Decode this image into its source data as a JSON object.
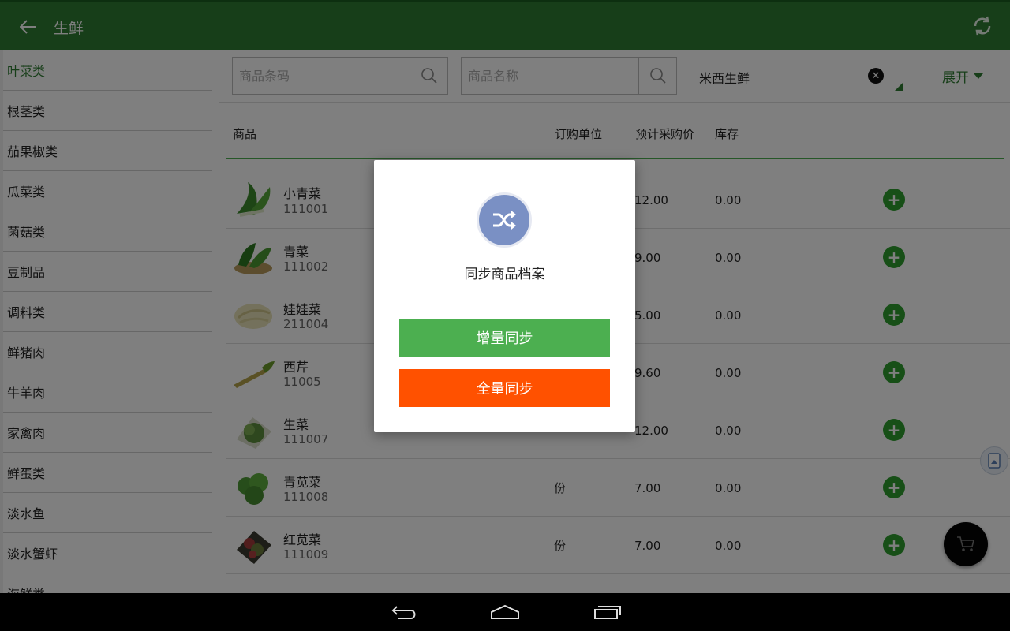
{
  "appbar": {
    "title": "生鲜",
    "back_icon": "arrow-back-icon",
    "sync_icon": "sync-icon"
  },
  "sidebar": {
    "items": [
      {
        "label": "叶菜类",
        "active": true
      },
      {
        "label": "根茎类"
      },
      {
        "label": "茄果椒类"
      },
      {
        "label": "瓜菜类"
      },
      {
        "label": "菌菇类"
      },
      {
        "label": "豆制品"
      },
      {
        "label": "调料类"
      },
      {
        "label": "鲜猪肉"
      },
      {
        "label": "牛羊肉"
      },
      {
        "label": "家禽肉"
      },
      {
        "label": "鲜蛋类"
      },
      {
        "label": "淡水鱼"
      },
      {
        "label": "淡水蟹虾"
      },
      {
        "label": "海鲜类"
      }
    ]
  },
  "search": {
    "barcode_placeholder": "商品条码",
    "name_placeholder": "商品名称",
    "store_name": "米西生鲜",
    "expand_label": "展开"
  },
  "table": {
    "headers": {
      "product": "商品",
      "unit": "订购单位",
      "price": "预计采购价",
      "stock": "库存"
    },
    "rows": [
      {
        "name": "小青菜",
        "code": "111001",
        "unit": "",
        "price": "12.00",
        "stock": "0.00"
      },
      {
        "name": "青菜",
        "code": "111002",
        "unit": "",
        "price": "9.00",
        "stock": "0.00"
      },
      {
        "name": "娃娃菜",
        "code": "211004",
        "unit": "",
        "price": "5.00",
        "stock": "0.00"
      },
      {
        "name": "西芹",
        "code": "11005",
        "unit": "",
        "price": "9.60",
        "stock": "0.00"
      },
      {
        "name": "生菜",
        "code": "111007",
        "unit": "",
        "price": "12.00",
        "stock": "0.00"
      },
      {
        "name": "青苋菜",
        "code": "111008",
        "unit": "份",
        "price": "7.00",
        "stock": "0.00"
      },
      {
        "name": "红苋菜",
        "code": "111009",
        "unit": "份",
        "price": "7.00",
        "stock": "0.00"
      }
    ]
  },
  "dialog": {
    "title": "同步商品档案",
    "icon": "shuffle-icon",
    "incremental_label": "增量同步",
    "full_label": "全量同步"
  },
  "colors": {
    "brand_green": "#2e7d32",
    "button_green": "#4caf50",
    "button_orange": "#ff5100"
  }
}
